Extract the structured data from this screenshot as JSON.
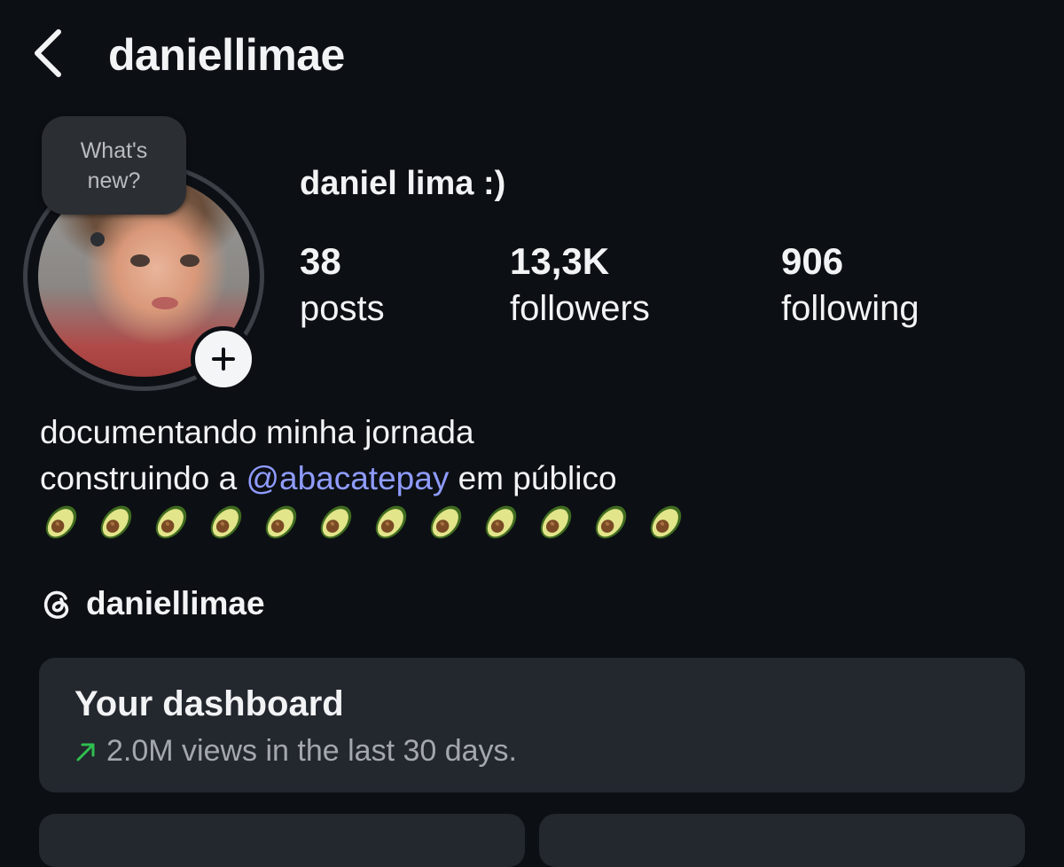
{
  "header": {
    "username": "daniellimae"
  },
  "avatar": {
    "note_line1": "What's",
    "note_line2": "new?"
  },
  "profile": {
    "display_name": "daniel lima :)",
    "stats": [
      {
        "value": "38",
        "label": "posts"
      },
      {
        "value": "13,3K",
        "label": "followers"
      },
      {
        "value": "906",
        "label": "following"
      }
    ]
  },
  "bio": {
    "line1": "documentando minha jornada",
    "line2_prefix": "construindo a ",
    "mention": "@abacatepay",
    "line2_suffix": " em público",
    "avocado_count": 12
  },
  "threads": {
    "handle": "daniellimae"
  },
  "dashboard": {
    "title": "Your dashboard",
    "subtitle": "2.0M views in the last 30 days."
  },
  "colors": {
    "background": "#0c0f14",
    "mention": "#8f9cff",
    "trend_up": "#2fbf4f",
    "card": "#23272e"
  }
}
